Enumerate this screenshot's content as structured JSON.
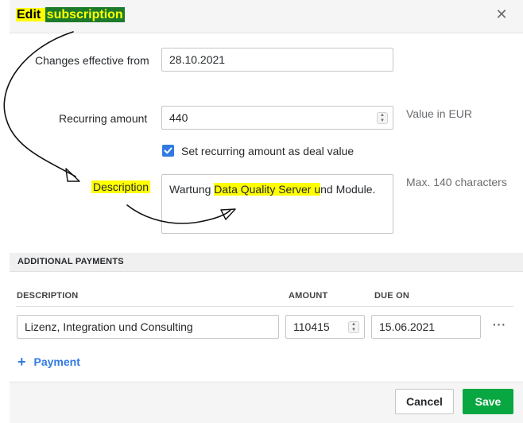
{
  "dialog": {
    "title_prefix": "Edit ",
    "title_highlight": "subscription",
    "close_glyph": "✕"
  },
  "form": {
    "effective_label": "Changes effective from",
    "effective_value": "28.10.2021",
    "recurring_label": "Recurring amount",
    "recurring_value": "440",
    "recurring_hint": "Value in EUR",
    "checkbox_label": "Set recurring amount as deal value",
    "checkbox_checked": true,
    "description_label": "Description",
    "description_hint": "Max. 140 characters",
    "description_before": "Wartung ",
    "description_highlight": "Data Quality Server u",
    "description_after": "nd Module."
  },
  "additional_payments": {
    "section_title": "ADDITIONAL PAYMENTS",
    "columns": {
      "description": "DESCRIPTION",
      "amount": "AMOUNT",
      "due_on": "DUE ON"
    },
    "rows": [
      {
        "description": "Lizenz, Integration und Consulting",
        "amount": "110415",
        "due_on": "15.06.2021"
      }
    ],
    "more_glyph": "···",
    "add_label": "Payment",
    "add_glyph": "+"
  },
  "footer": {
    "cancel_label": "Cancel",
    "save_label": "Save"
  },
  "colors": {
    "accent_blue": "#317ae2",
    "save_green": "#08a742",
    "highlight_yellow": "#ffff00",
    "title_highlight_bg": "#1d7a2b"
  },
  "icons": [
    "close-icon",
    "checkmark-icon",
    "spinner-up-icon",
    "spinner-down-icon",
    "more-icon",
    "plus-icon"
  ]
}
